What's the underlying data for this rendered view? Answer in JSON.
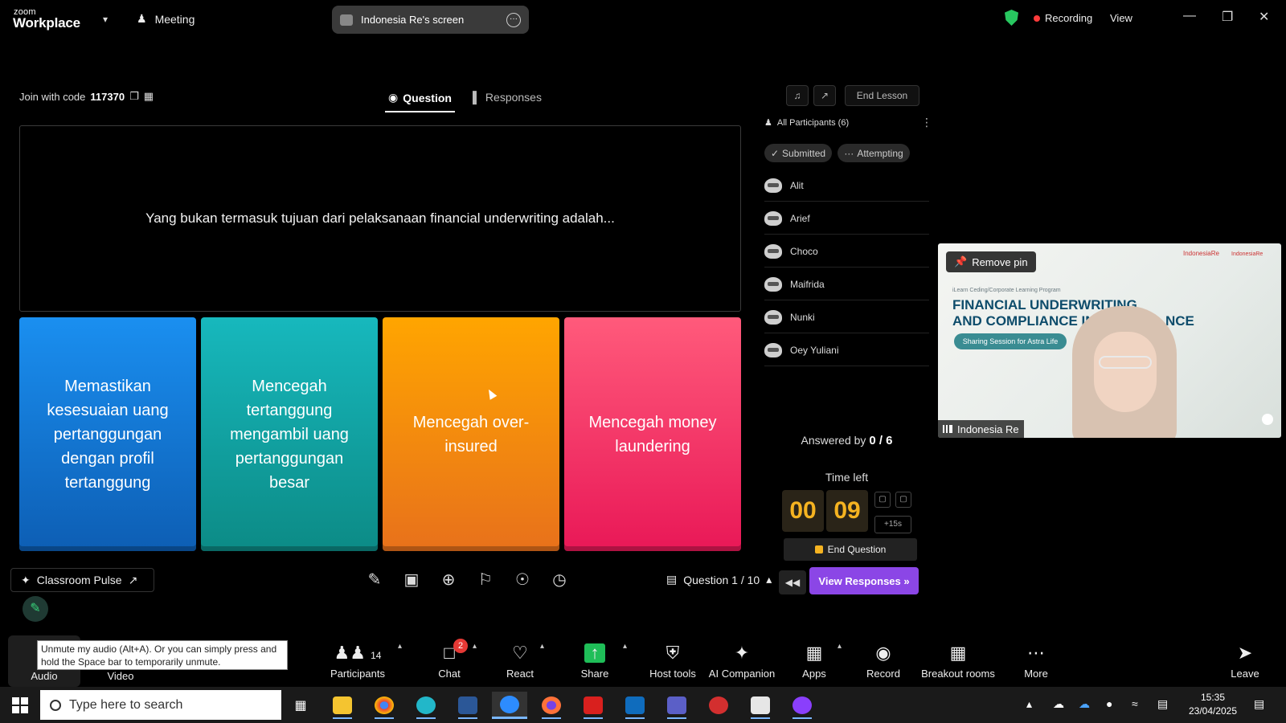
{
  "window": {
    "logo_small": "zoom",
    "logo_big": "Workplace",
    "meeting_label": "Meeting",
    "screen_share_label": "Indonesia Re's screen",
    "recording_label": "Recording",
    "view_label": "View"
  },
  "lesson": {
    "join_label": "Join with code",
    "join_code": "117370",
    "tabs": [
      {
        "label": "Question",
        "active": true
      },
      {
        "label": "Responses",
        "active": false
      }
    ],
    "end_lesson_label": "End Lesson",
    "question": "Yang bukan termasuk tujuan dari pelaksanaan financial underwriting adalah...",
    "answers": [
      {
        "text": "Memastikan kesesuaian uang pertanggungan dengan profil tertanggung",
        "color": "#1a8ff0"
      },
      {
        "text": "Mencegah tertanggung mengambil uang pertanggungan besar",
        "color": "#17b8bd"
      },
      {
        "text": "Mencegah over-insured",
        "color": "#ffa500"
      },
      {
        "text": "Mencegah money laundering",
        "color": "#ff5a7b"
      }
    ],
    "participants": {
      "header": "All Participants (6)",
      "filters": [
        "Submitted",
        "Attempting"
      ],
      "list": [
        "Alit",
        "Arief",
        "Choco",
        "Maifrida",
        "Nunki",
        "Oey Yuliani"
      ]
    },
    "answered_label": "Answered by",
    "answered_value": "0 / 6",
    "time_left_label": "Time left",
    "time_minutes": "00",
    "time_seconds": "09",
    "add_time_label": "+15s",
    "end_question_label": "End Question",
    "classroom_pulse_label": "Classroom Pulse",
    "question_counter": "Question 1 / 10",
    "view_responses_label": "View Responses"
  },
  "video": {
    "remove_pin_label": "Remove pin",
    "name": "Indonesia Re",
    "slide_program": "iLearn Ceding/Corporate Learning Program",
    "slide_title_line1": "FINANCIAL UNDERWRITING",
    "slide_title_line2": "AND COMPLIANCE IN I",
    "slide_title_tail": "NCE",
    "slide_pill": "Sharing Session for Astra Life",
    "logo_left": "IndonesiaRe",
    "logo_right": "IndonesiaRe"
  },
  "toolbar": {
    "tooltip": "Unmute my audio (Alt+A). Or you can simply press and hold the Space bar to temporarily unmute.",
    "audio": "Audio",
    "video": "Video",
    "participants": "Participants",
    "participants_count": "14",
    "chat": "Chat",
    "chat_badge": "2",
    "react": "React",
    "share": "Share",
    "host_tools": "Host tools",
    "ai_companion": "AI Companion",
    "apps": "Apps",
    "record": "Record",
    "breakout_rooms": "Breakout rooms",
    "more": "More",
    "leave": "Leave"
  },
  "taskbar": {
    "search_placeholder": "Type here to search",
    "time": "15:35",
    "date": "23/04/2025",
    "apps": [
      "file-explorer",
      "chrome",
      "canva",
      "word",
      "zoom",
      "firefox",
      "acrobat",
      "outlook",
      "teams",
      "shield-app",
      "elo",
      "media-player"
    ]
  },
  "colors": {
    "accent_purple": "#8b46e6",
    "timer_amber": "#f5b321",
    "shield_green": "#28c760"
  }
}
